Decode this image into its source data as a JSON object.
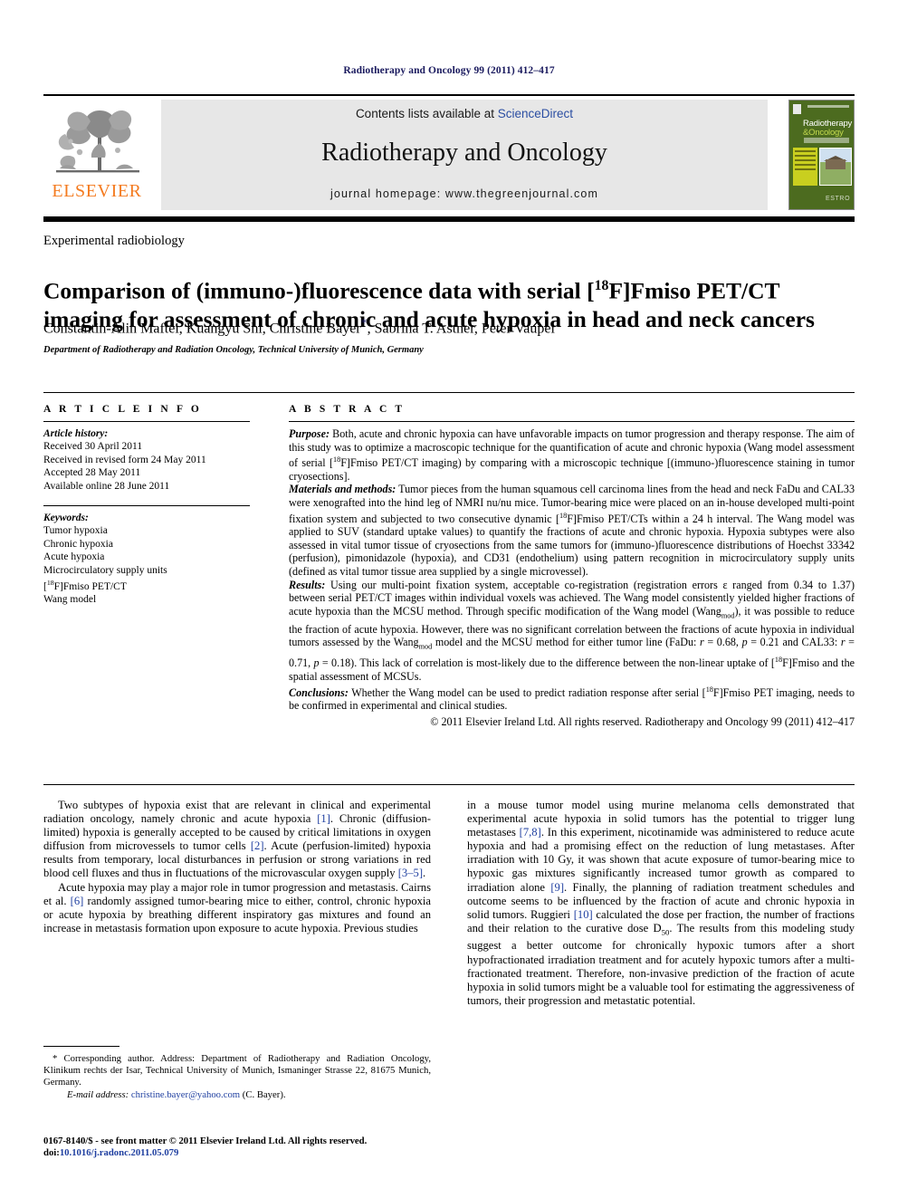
{
  "running_head": "Radiotherapy and Oncology 99 (2011) 412–417",
  "header": {
    "contents_prefix": "Contents lists available at ",
    "sciencedirect": "ScienceDirect",
    "journal_name": "Radiotherapy and Oncology",
    "homepage": "journal homepage: www.thegreenjournal.com",
    "publisher_logo_text": "ELSEVIER",
    "cover": {
      "title_line1": "Radiotherapy",
      "title_line2": "&Oncology",
      "brand": "ESTRO"
    }
  },
  "article": {
    "section_kicker": "Experimental radiobiology",
    "title_part1": "Comparison of (immuno-)fluorescence data with serial [",
    "title_sup": "18",
    "title_part2": "F]Fmiso PET/CT imaging for assessment of chronic and acute hypoxia in head and neck cancers",
    "authors": "Constantin-Alin Maftei, Kuangyu Shi, Christine Bayer",
    "authors_tail": ", Sabrina T. Astner, Peter Vaupel",
    "corresponding_marker": "*",
    "affiliation": "Department of Radiotherapy and Radiation Oncology, Technical University of Munich, Germany"
  },
  "info": {
    "heading": "A R T I C L E   I N F O",
    "history_label": "Article history:",
    "history": [
      "Received 30 April 2011",
      "Received in revised form 24 May 2011",
      "Accepted 28 May 2011",
      "Available online 28 June 2011"
    ],
    "keywords_label": "Keywords:",
    "keywords": [
      "Tumor hypoxia",
      "Chronic hypoxia",
      "Acute hypoxia",
      "Microcirculatory supply units",
      "[18F]Fmiso PET/CT",
      "Wang model"
    ],
    "keyword_fmiso_pre": "[",
    "keyword_fmiso_sup": "18",
    "keyword_fmiso_post": "F]Fmiso PET/CT"
  },
  "abstract": {
    "heading": "A B S T R A C T",
    "purpose_label": "Purpose:",
    "purpose_a": " Both, acute and chronic hypoxia can have unfavorable impacts on tumor progression and therapy response. The aim of this study was to optimize a macroscopic technique for the quantification of acute and chronic hypoxia (Wang model assessment of serial [",
    "purpose_sup1": "18",
    "purpose_b": "F]Fmiso PET/CT imaging) by comparing with a microscopic technique [(immuno-)fluorescence staining in tumor cryosections].",
    "methods_label": "Materials and methods:",
    "methods_a": " Tumor pieces from the human squamous cell carcinoma lines from the head and neck FaDu and CAL33 were xenografted into the hind leg of NMRI nu/nu mice. Tumor-bearing mice were placed on an in-house developed multi-point fixation system and subjected to two consecutive dynamic [",
    "methods_sup1": "18",
    "methods_b": "F]Fmiso PET/CTs within a 24 h interval. The Wang model was applied to SUV (standard uptake values) to quantify the fractions of acute and chronic hypoxia. Hypoxia subtypes were also assessed in vital tumor tissue of cryosections from the same tumors for (immuno-)fluorescence distributions of Hoechst 33342 (perfusion), pimonidazole (hypoxia), and CD31 (endothelium) using pattern recognition in microcirculatory supply units (defined as vital tumor tissue area supplied by a single microvessel).",
    "results_label": "Results:",
    "results_a": " Using our multi-point fixation system, acceptable co-registration (registration errors ε ranged from 0.34 to 1.37) between serial PET/CT images within individual voxels was achieved. The Wang model consistently yielded higher fractions of acute hypoxia than the MCSU method. Through specific modification of the Wang model (Wang",
    "results_sub1": "mod",
    "results_b": "), it was possible to reduce the fraction of acute hypoxia. However, there was no significant correlation between the fractions of acute hypoxia in individual tumors assessed by the Wang",
    "results_sub2": "mod",
    "results_c": " model and the MCSU method for either tumor line (FaDu: ",
    "results_r1": "r",
    "results_d": " = 0.68, ",
    "results_p1": "p",
    "results_e": " = 0.21 and CAL33: ",
    "results_r2": "r",
    "results_f": " = 0.71, ",
    "results_p2": "p",
    "results_g": " = 0.18). This lack of correlation is most-likely due to the difference between the non-linear uptake of [",
    "results_sup2": "18",
    "results_h": "F]Fmiso and the spatial assessment of MCSUs.",
    "conclusions_label": "Conclusions:",
    "conclusions_a": " Whether the Wang model can be used to predict radiation response after serial [",
    "conclusions_sup1": "18",
    "conclusions_b": "F]Fmiso PET imaging, needs to be confirmed in experimental and clinical studies.",
    "copyright": "© 2011 Elsevier Ireland Ltd. All rights reserved. Radiotherapy and Oncology 99 (2011) 412–417"
  },
  "body": {
    "left_p1_a": "Two subtypes of hypoxia exist that are relevant in clinical and experimental radiation oncology, namely chronic and acute hypoxia ",
    "left_p1_r1": "[1]",
    "left_p1_b": ". Chronic (diffusion-limited) hypoxia is generally accepted to be caused by critical limitations in oxygen diffusion from microvessels to tumor cells ",
    "left_p1_r2": "[2]",
    "left_p1_c": ". Acute (perfusion-limited) hypoxia results from temporary, local disturbances in perfusion or strong variations in red blood cell fluxes and thus in fluctuations of the microvascular oxygen supply ",
    "left_p1_r3": "[3–5]",
    "left_p1_d": ".",
    "left_p2_a": "Acute hypoxia may play a major role in tumor progression and metastasis. Cairns et al. ",
    "left_p2_r1": "[6]",
    "left_p2_b": " randomly assigned tumor-bearing mice to either, control, chronic hypoxia or acute hypoxia by breathing different inspiratory gas mixtures and found an increase in metastasis formation upon exposure to acute hypoxia. Previous studies",
    "right_p1_a": "in a mouse tumor model using murine melanoma cells demonstrated that experimental acute hypoxia in solid tumors has the potential to trigger lung metastases ",
    "right_p1_r1": "[7,8]",
    "right_p1_b": ". In this experiment, nicotinamide was administered to reduce acute hypoxia and had a promising effect on the reduction of lung metastases. After irradiation with 10 Gy, it was shown that acute exposure of tumor-bearing mice to hypoxic gas mixtures significantly increased tumor growth as compared to irradiation alone ",
    "right_p1_r2": "[9]",
    "right_p1_c": ". Finally, the planning of radiation treatment schedules and outcome seems to be influenced by the fraction of acute and chronic hypoxia in solid tumors. Ruggieri ",
    "right_p1_r3": "[10]",
    "right_p1_d": " calculated the dose per fraction, the number of fractions and their relation to the curative dose D",
    "right_p1_sub": "50",
    "right_p1_e": ". The results from this modeling study suggest a better outcome for chronically hypoxic tumors after a short hypofractionated irradiation treatment and for acutely hypoxic tumors after a multi-fractionated treatment. Therefore, non-invasive prediction of the fraction of acute hypoxia in solid tumors might be a valuable tool for estimating the aggressiveness of tumors, their progression and metastatic potential."
  },
  "footer": {
    "corr_marker": "*",
    "corr_text": " Corresponding author. Address: Department of Radiotherapy and Radiation Oncology, Klinikum rechts der Isar, Technical University of Munich, Ismaninger Strasse 22, 81675 Munich, Germany.",
    "email_label": "E-mail address:",
    "email": "christine.bayer@yahoo.com",
    "email_owner": " (C. Bayer).",
    "issn_line": "0167-8140/$ - see front matter © 2011 Elsevier Ireland Ltd. All rights reserved.",
    "doi_label": "doi:",
    "doi": "10.1016/j.radonc.2011.05.079"
  },
  "colors": {
    "running_head": "#1a1a5e",
    "sciencedirect": "#2b4ea2",
    "elsevier_orange": "#F47B20",
    "reference_link": "#1f3fa0",
    "band_gray": "#e7e7e7",
    "cover_green": "#4c6b1f"
  }
}
